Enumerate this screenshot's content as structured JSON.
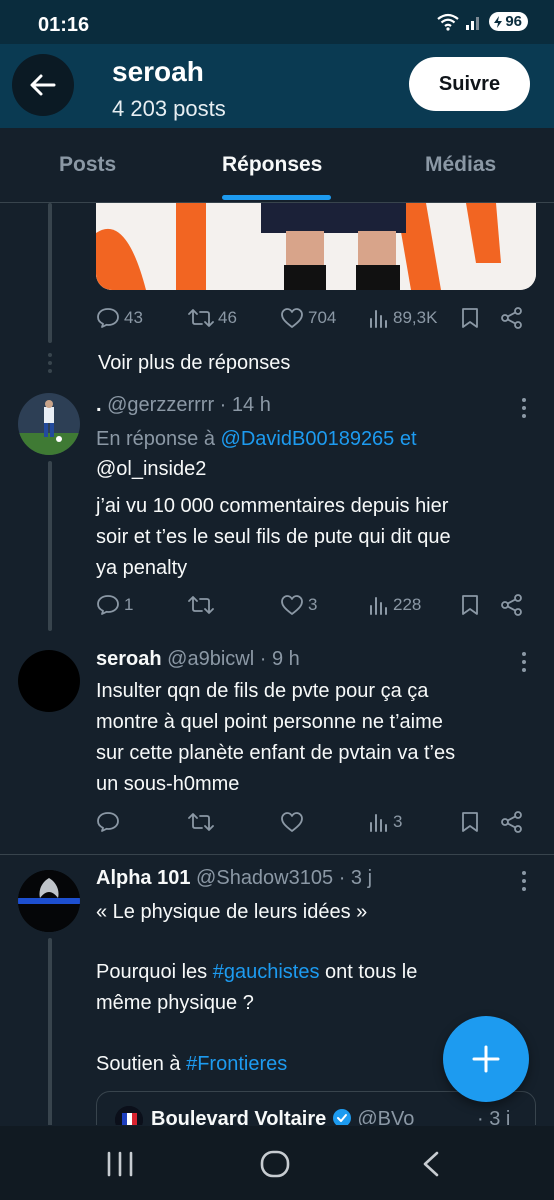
{
  "status": {
    "time": "01:16",
    "battery": "96"
  },
  "header": {
    "title": "seroah",
    "subtitle": "4 203 posts",
    "follow": "Suivre"
  },
  "tabs": [
    {
      "label": "Posts"
    },
    {
      "label": "Réponses"
    },
    {
      "label": "Médias"
    }
  ],
  "post0": {
    "replies": "43",
    "reposts": "46",
    "likes": "704",
    "views": "89,3K"
  },
  "show_more": "Voir plus de réponses",
  "reply1": {
    "name": ".",
    "handle": "@gerzzerrrr",
    "time": "· 14 h",
    "in_reply_prefix": "En réponse à",
    "mention1": "@DavidB00189265",
    "conj": "et",
    "mention2": "@ol_inside2",
    "lines": [
      "j’ai vu 10 000 commentaires depuis hier",
      "soir et t’es le seul fils de pute qui dit que",
      "ya penalty"
    ],
    "replies": "1",
    "reposts": "",
    "likes": "3",
    "views": "228"
  },
  "reply2": {
    "name": "seroah",
    "handle": "@a9bicwl",
    "time": "· 9 h",
    "lines": [
      "Insulter qqn de fils de pvte pour ça ça",
      "montre à quel point personne ne t’aime",
      "sur cette planète enfant de pvtain va t’es",
      "un sous-h0mme"
    ],
    "replies": "",
    "reposts": "",
    "likes": "",
    "views": "3"
  },
  "post3": {
    "name": "Alpha 101",
    "handle": "@Shadow3105",
    "time": "· 3 j",
    "line1": "«  Le physique de leurs idées »",
    "line2_pre": "Pourquoi les ",
    "line2_tag": "#gauchistes",
    "line2_post": " ont tous le",
    "line3": "même physique ?",
    "line4_pre": "Soutien à ",
    "line4_tag": "#Frontieres",
    "quote_name": "Boulevard Voltaire",
    "quote_handle": "@BVo",
    "quote_time": "· 3 j"
  },
  "colors": {
    "accent": "#1d9bf0",
    "background": "#15202b",
    "header": "#0a3a52"
  }
}
